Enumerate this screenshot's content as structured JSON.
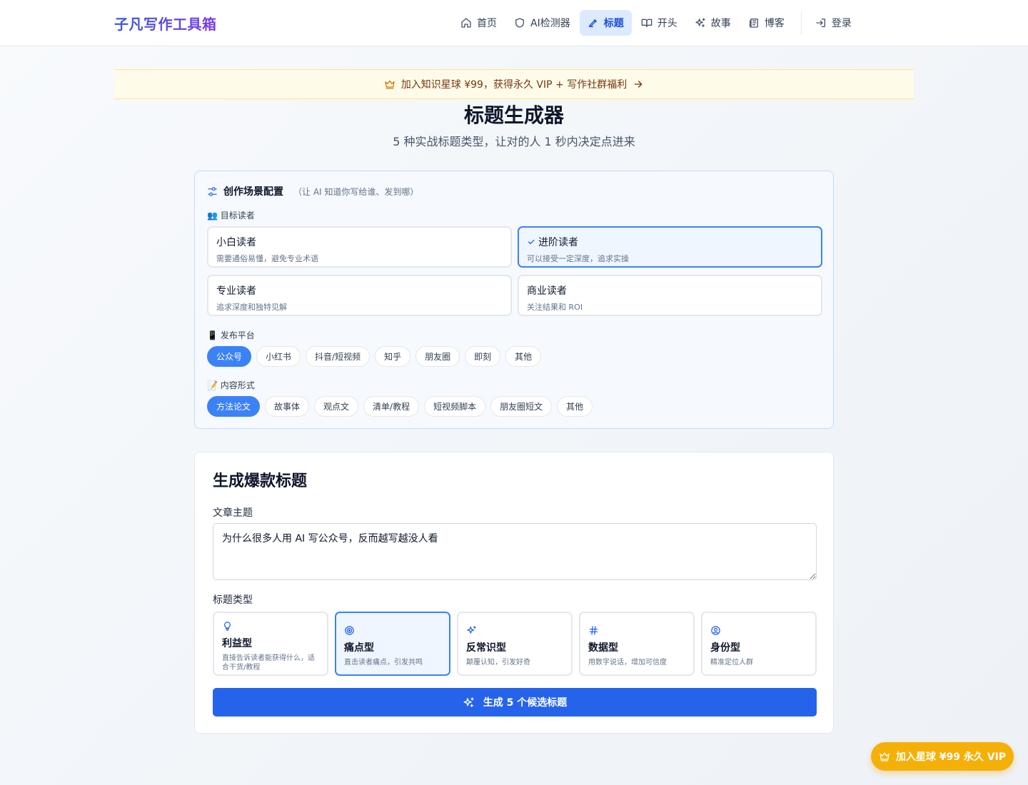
{
  "header": {
    "logo": "子凡写作工具箱",
    "nav": [
      {
        "label": "首页",
        "icon": "home-icon"
      },
      {
        "label": "AI检测器",
        "icon": "shield-icon"
      },
      {
        "label": "标题",
        "icon": "pen-icon",
        "active": true
      },
      {
        "label": "开头",
        "icon": "book-open-icon"
      },
      {
        "label": "故事",
        "icon": "sparkles-icon"
      },
      {
        "label": "博客",
        "icon": "newspaper-icon"
      }
    ],
    "login": "登录"
  },
  "banner": {
    "text": "加入知识星球 ¥99，获得永久 VIP + 写作社群福利"
  },
  "page": {
    "title": "标题生成器",
    "subtitle": "5 种实战标题类型，让对的人 1 秒内决定点进来"
  },
  "config": {
    "title": "创作场景配置",
    "hint": "（让 AI 知道你写给谁、发到哪）",
    "reader_label": "👥 目标读者",
    "readers": [
      {
        "name": "小白读者",
        "desc": "需要通俗易懂，避免专业术语"
      },
      {
        "name": "进阶读者",
        "desc": "可以接受一定深度，追求实操",
        "selected": true
      },
      {
        "name": "专业读者",
        "desc": "追求深度和独特见解"
      },
      {
        "name": "商业读者",
        "desc": "关注结果和 ROI"
      }
    ],
    "platform_label": "📱 发布平台",
    "platforms": [
      "公众号",
      "小红书",
      "抖音/短视频",
      "知乎",
      "朋友圈",
      "即刻",
      "其他"
    ],
    "platform_selected": "公众号",
    "format_label": "📝 内容形式",
    "formats": [
      "方法论文",
      "故事体",
      "观点文",
      "清单/教程",
      "短视频脚本",
      "朋友圈短文",
      "其他"
    ],
    "format_selected": "方法论文"
  },
  "generator": {
    "title": "生成爆款标题",
    "topic_label": "文章主题",
    "topic_value": "为什么很多人用 AI 写公众号，反而越写越没人看",
    "type_label": "标题类型",
    "types": [
      {
        "name": "利益型",
        "desc": "直接告诉读者能获得什么，适合干货/教程",
        "icon": "lightbulb-icon"
      },
      {
        "name": "痛点型",
        "desc": "直击读者痛点，引发共鸣",
        "icon": "target-icon",
        "selected": true
      },
      {
        "name": "反常识型",
        "desc": "颠覆认知，引发好奇",
        "icon": "sparkles-icon"
      },
      {
        "name": "数据型",
        "desc": "用数字说话，增加可信度",
        "icon": "hash-icon"
      },
      {
        "name": "身份型",
        "desc": "精准定位人群",
        "icon": "user-circle-icon"
      }
    ],
    "button": "生成 5 个候选标题"
  },
  "float_button": "加入星球 ¥99 永久 VIP",
  "colors": {
    "accent": "#2563eb",
    "selected_border": "#3b82f6",
    "banner_bg": "#fefce8",
    "vip": "#f5b008"
  }
}
